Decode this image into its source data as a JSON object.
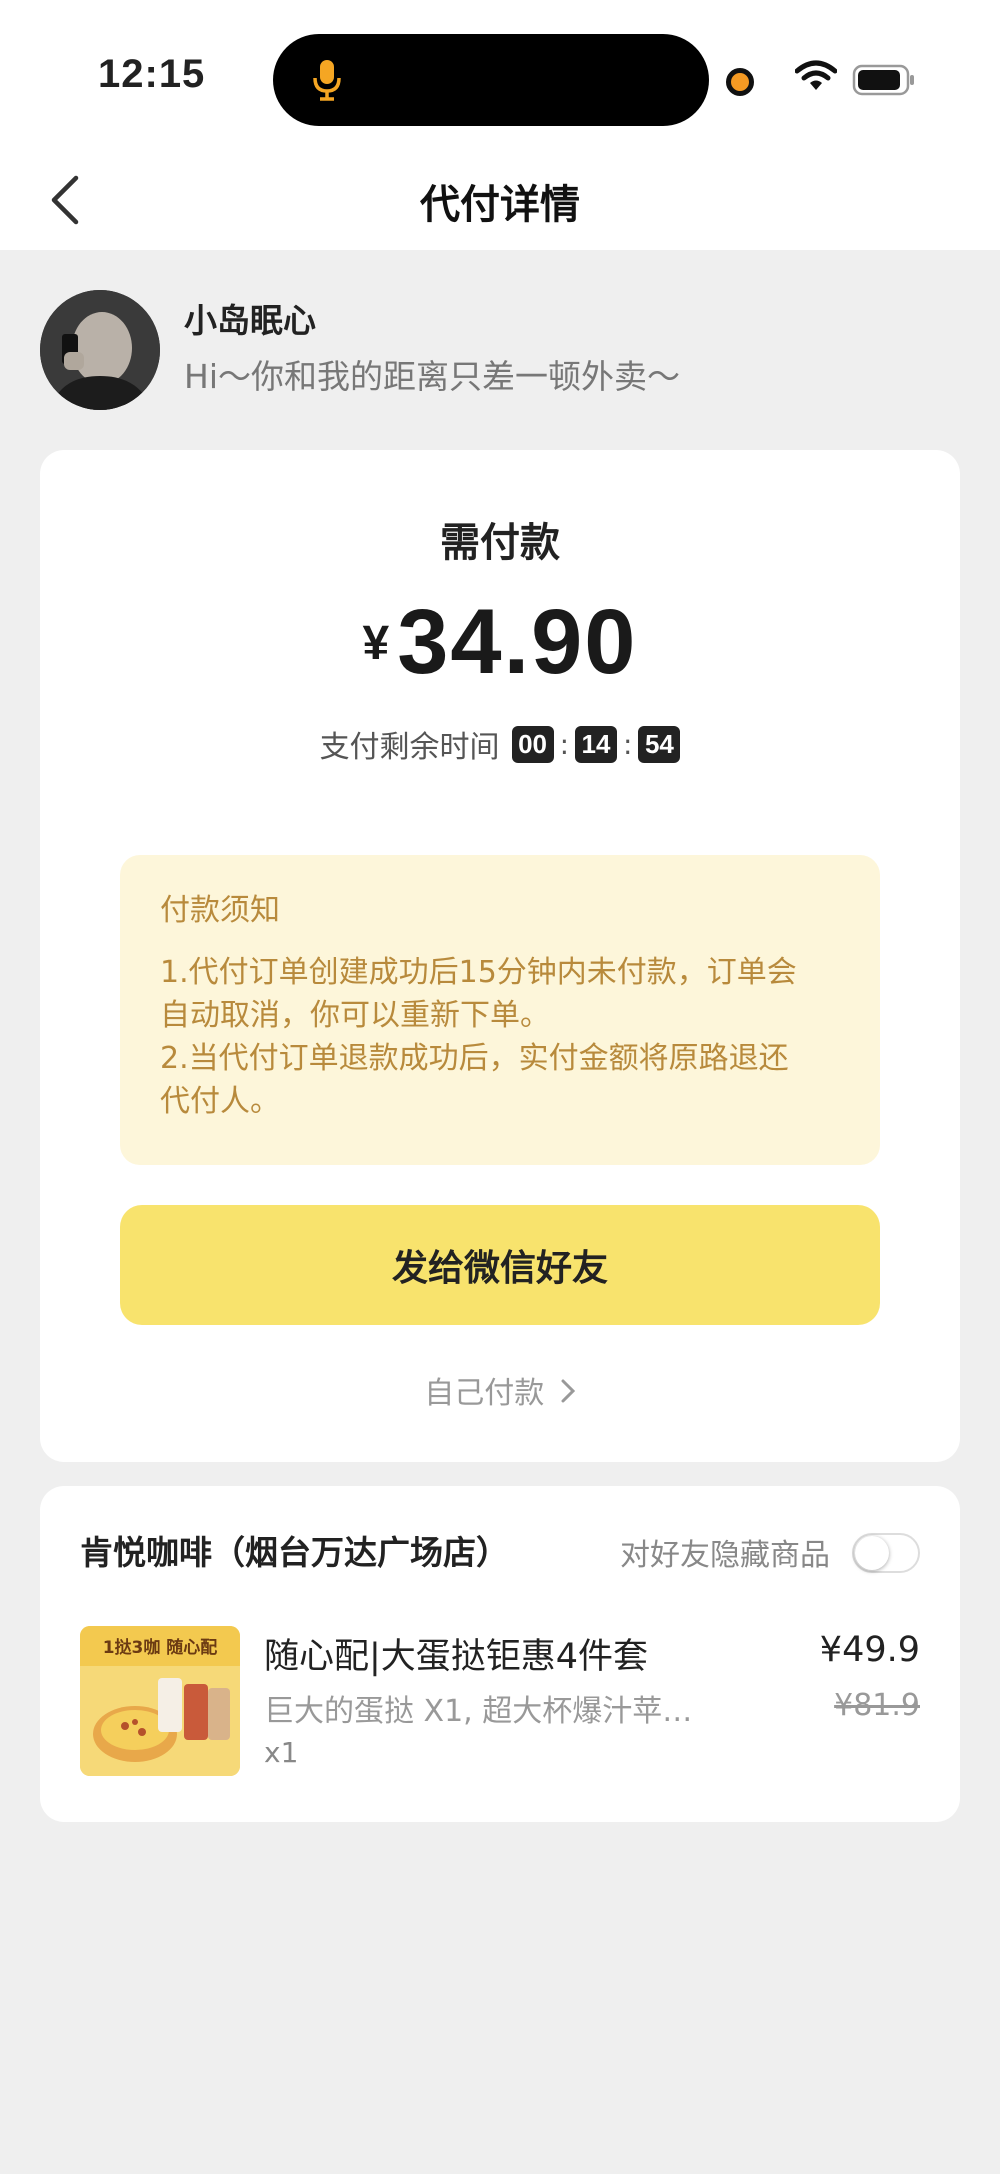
{
  "status_bar": {
    "time": "12:15"
  },
  "nav": {
    "title": "代付详情"
  },
  "user": {
    "name": "小岛眠心",
    "message": "Hi～你和我的距离只差一顿外卖～"
  },
  "payment": {
    "title": "需付款",
    "currency": "¥",
    "amount": "34.90",
    "remaining_label": "支付剩余时间",
    "countdown": {
      "hours": "00",
      "minutes": "14",
      "seconds": "54"
    }
  },
  "notice": {
    "title": "付款须知",
    "lines": [
      "1.代付订单创建成功后15分钟内未付款，订单会",
      "自动取消，你可以重新下单。",
      "2.当代付订单退款成功后，实付金额将原路退还",
      "代付人。"
    ]
  },
  "actions": {
    "send_button": "发给微信好友",
    "self_pay": "自己付款"
  },
  "order": {
    "shop_name": "肯悦咖啡（烟台万达广场店）",
    "hide_label": "对好友隐藏商品",
    "hide_toggle_on": false,
    "product": {
      "image_text": "1挞3咖 随心配",
      "name": "随心配|大蛋挞钜惠4件套",
      "desc": "巨大的蛋挞 X1, 超大杯爆汁苹…",
      "qty": "x1",
      "price": "¥49.9",
      "original_price": "¥81.9"
    }
  },
  "colors": {
    "accent_yellow": "#f8e36d",
    "notice_bg": "#fdf6da",
    "notice_text": "#b88a3c"
  }
}
